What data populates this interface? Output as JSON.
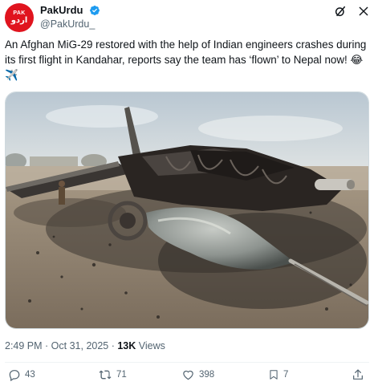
{
  "author": {
    "display_name": "PakUrdu",
    "handle": "@PakUrdu_",
    "avatar_text_top": "PAK",
    "avatar_text_bottom": "اردو",
    "verified_color": "#1d9bf0"
  },
  "header_icons": [
    "grok-icon",
    "close-icon"
  ],
  "tweet": {
    "text": "An Afghan MiG-29 restored with the help of Indian engineers crashes during its first flight in Kandahar, reports say the team has ‘flown’ to Nepal now! 😂✈️"
  },
  "media": {
    "description_icon": "crashed-jet-photo"
  },
  "meta": {
    "time": "2:49 PM",
    "separator1": " · ",
    "date": "Oct 31, 2025",
    "separator2": " · ",
    "views_count": "13K",
    "views_label": " Views"
  },
  "actions": {
    "replies": "43",
    "reposts": "71",
    "likes": "398",
    "bookmarks": "7"
  },
  "colors": {
    "brand_red": "#e0141e",
    "text_secondary": "#536471",
    "text_primary": "#0f1419"
  }
}
